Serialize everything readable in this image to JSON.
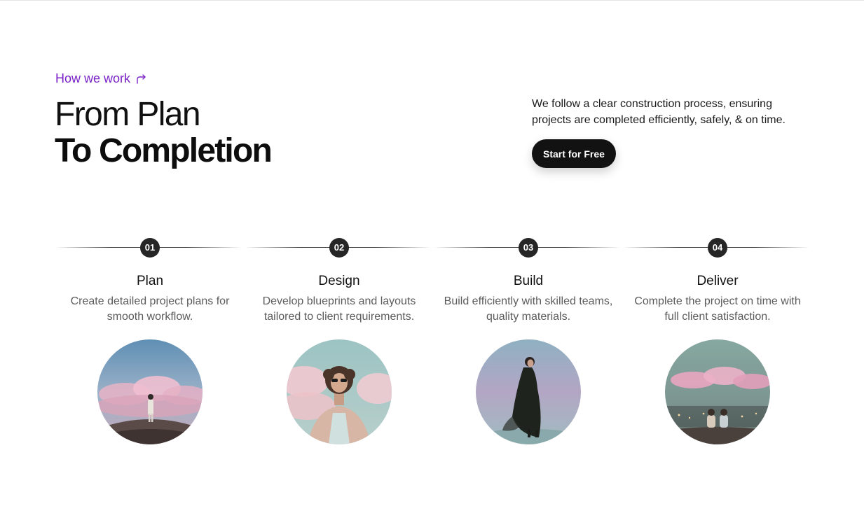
{
  "header": {
    "eyebrow_label": "How we work",
    "title_line1": "From Plan",
    "title_line2": "To Completion",
    "intro": "We follow a clear construction process, ensuring projects are completed efficiently, safely, & on time.",
    "cta_label": "Start for Free"
  },
  "colors": {
    "accent": "#7a22c7",
    "button": "#121212",
    "step_badge": "#262626"
  },
  "steps": [
    {
      "number": "01",
      "title": "Plan",
      "description": "Create detailed project plans for smooth workflow.",
      "image_icon": "person-on-hill-clouds-photo"
    },
    {
      "number": "02",
      "title": "Design",
      "description": "Develop blueprints and layouts tailored to client requirements.",
      "image_icon": "woman-sunglasses-portrait-photo"
    },
    {
      "number": "03",
      "title": "Build",
      "description": "Build efficiently with skilled teams, quality materials.",
      "image_icon": "walking-figure-coat-photo"
    },
    {
      "number": "04",
      "title": "Deliver",
      "description": "Complete the project on time with full client satisfaction.",
      "image_icon": "couple-sitting-city-view-photo"
    }
  ]
}
